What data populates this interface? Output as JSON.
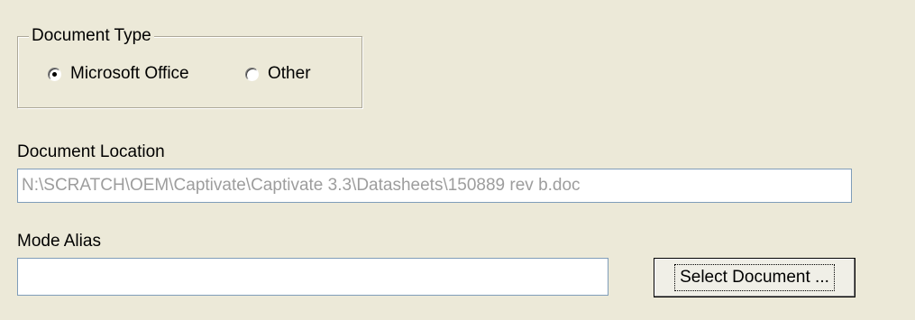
{
  "document_type": {
    "group_label": "Document Type",
    "options": [
      {
        "label": "Microsoft Office",
        "checked": true
      },
      {
        "label": "Other",
        "checked": false
      }
    ]
  },
  "document_location": {
    "label": "Document Location",
    "value": "N:\\SCRATCH\\OEM\\Captivate\\Captivate 3.3\\Datasheets\\150889 rev b.doc"
  },
  "mode_alias": {
    "label": "Mode Alias",
    "value": ""
  },
  "select_button": {
    "label": "Select Document ..."
  }
}
